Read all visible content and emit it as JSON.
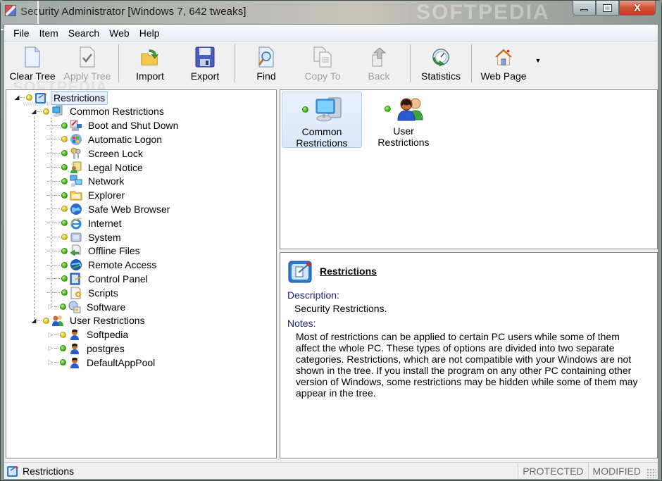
{
  "window": {
    "title": "Security Administrator [Windows 7, 642 tweaks]",
    "watermark": "SOFTPEDIA",
    "controls": {
      "minimize": "minimize",
      "maximize": "maximize",
      "close": "X"
    }
  },
  "menu": [
    "File",
    "Item",
    "Search",
    "Web",
    "Help"
  ],
  "toolbar": {
    "buttons": [
      {
        "label": "Clear Tree",
        "icon": "blank-document-icon",
        "enabled": true
      },
      {
        "label": "Apply Tree",
        "icon": "checked-document-icon",
        "enabled": false
      },
      {
        "label": "Import",
        "icon": "folder-import-icon",
        "enabled": true
      },
      {
        "label": "Export",
        "icon": "floppy-disk-icon",
        "enabled": true
      },
      {
        "label": "Find",
        "icon": "magnifier-document-icon",
        "enabled": true
      },
      {
        "label": "Copy To",
        "icon": "copy-documents-icon",
        "enabled": false
      },
      {
        "label": "Back",
        "icon": "back-arrow-icon",
        "enabled": false
      },
      {
        "label": "Statistics",
        "icon": "statistics-clock-icon",
        "enabled": true
      },
      {
        "label": "Web Page",
        "icon": "home-icon",
        "enabled": true
      }
    ],
    "dropdown_glyph": "▼"
  },
  "tree": {
    "root": {
      "label": "Restrictions",
      "status": "yellow",
      "selected": true
    },
    "common": {
      "label": "Common Restrictions",
      "status": "yellow",
      "items": [
        {
          "label": "Boot and Shut Down",
          "status": "green",
          "icon": "boot-lock-icon"
        },
        {
          "label": "Automatic Logon",
          "status": "yellow",
          "icon": "windows-logo-icon"
        },
        {
          "label": "Screen Lock",
          "status": "green",
          "icon": "keys-icon"
        },
        {
          "label": "Legal Notice",
          "status": "green",
          "icon": "legal-notice-icon"
        },
        {
          "label": "Network",
          "status": "green",
          "icon": "network-icon"
        },
        {
          "label": "Explorer",
          "status": "green",
          "icon": "folder-icon"
        },
        {
          "label": "Safe Web Browser",
          "status": "yellow",
          "icon": "globe-icon"
        },
        {
          "label": "Internet",
          "status": "green",
          "icon": "ie-icon"
        },
        {
          "label": "System",
          "status": "yellow",
          "icon": "system-icon"
        },
        {
          "label": "Offline Files",
          "status": "green",
          "icon": "offline-files-icon"
        },
        {
          "label": "Remote Access",
          "status": "green",
          "icon": "remote-access-icon"
        },
        {
          "label": "Control Panel",
          "status": "green",
          "icon": "control-panel-icon"
        },
        {
          "label": "Scripts",
          "status": "green",
          "icon": "scripts-icon"
        },
        {
          "label": "Software",
          "status": "green",
          "icon": "software-icon",
          "collapsed": true
        }
      ]
    },
    "user": {
      "label": "User Restrictions",
      "status": "yellow",
      "items": [
        {
          "label": "Softpedia",
          "status": "yellow",
          "icon": "user-icon"
        },
        {
          "label": "postgres",
          "status": "green",
          "icon": "user-icon"
        },
        {
          "label": "DefaultAppPool",
          "status": "green",
          "icon": "user-icon"
        }
      ]
    }
  },
  "categories": [
    {
      "label_line1": "Common",
      "label_line2": "Restrictions",
      "status": "green",
      "selected": true
    },
    {
      "label_line1": "User",
      "label_line2": "Restrictions",
      "status": "green",
      "selected": false
    }
  ],
  "info": {
    "title": "Restrictions",
    "description_label": "Description:",
    "description": "Security Restrictions.",
    "notes_label": "Notes:",
    "notes": "Most of restrictions can be applied to certain PC users while some of them affect the whole PC. These types of options are divided into two separate categories. Restrictions, which are not compatible with your Windows are not shown in the tree. If you install the program on any other PC containing other version of Windows, some restrictions may be hidden while some of them may appear in the tree."
  },
  "statusbar": {
    "current": "Restrictions",
    "panels": [
      "PROTECTED",
      "MODIFIED"
    ]
  },
  "colors": {
    "status_green": "#3fb21a",
    "status_yellow": "#d8c520",
    "label_blue": "#1c1c80",
    "selection": "#e4efff"
  }
}
